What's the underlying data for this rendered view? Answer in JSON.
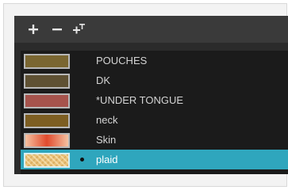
{
  "toolbar": {
    "add_icon": "plus-icon",
    "remove_icon": "minus-icon",
    "add_texture_icon": "add-texture-icon",
    "icon_color": "#e6e6e6"
  },
  "swatches": [
    {
      "label": "POUCHES",
      "fill": "#7a6631",
      "selected": false
    },
    {
      "label": "DK",
      "fill": "#5f5133",
      "selected": false
    },
    {
      "label": "*UNDER TONGUE",
      "fill": "#a6534c",
      "selected": false
    },
    {
      "label": "neck",
      "fill": "#7d5e22",
      "selected": false
    },
    {
      "label": "Skin",
      "gradient": [
        "#f5c2a1",
        "#e04a2d",
        "#f5c2a1"
      ],
      "selected": false
    },
    {
      "label": "plaid",
      "pattern": "plaid-texture",
      "colors": [
        "#e9c27a",
        "#f3d79b"
      ],
      "selected": true
    }
  ],
  "colors": {
    "panel_bg": "#2b2b2b",
    "list_bg": "#1b1b1b",
    "selection": "#2fa6bd",
    "text": "#d4d4d4"
  }
}
